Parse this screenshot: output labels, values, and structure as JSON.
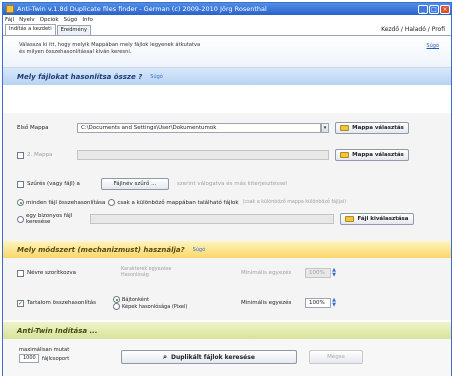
{
  "window": {
    "title": "Anti-Twin v.1.8d Duplicate files finder - German (c) 2009-2010 Jörg Rosenthal",
    "min": "_",
    "max": "□",
    "close": "×"
  },
  "menu": [
    "Fájl",
    "Nyelv",
    "Opciók",
    "Súgó",
    "Info"
  ],
  "tabs": [
    "Indítás a kezdeti",
    "Eredmény"
  ],
  "modes": "Kezdő / Haladó / Profi",
  "intro": {
    "text1": "Válassza ki itt, hogy melyik Mappában mely fájlok legyenek átkutatva",
    "text2": "és milyen összehasonlítással kíván keresni.",
    "help": "Súgó"
  },
  "section1": {
    "title": "Mely fájlokat hasonlítsa össze ?",
    "link": "Súgó"
  },
  "base_folder": {
    "label": "Első Mappa",
    "path": "C:\\Documents and Settings\\User\\Dokumentumok",
    "button": "Mappa választás"
  },
  "second_folder": {
    "label": "2. Mappa",
    "path": "",
    "button": "Mappa választás"
  },
  "filter": {
    "label": "Szűrés (vagy fájl) a",
    "button": "Fájlnév szűrő ...",
    "extra": "szerint válogatva és más kiterjesztéssel"
  },
  "scope": {
    "opt_all": "minden fájl összehasonlítása",
    "opt_sub": "csak a különböző mappában található fájlok",
    "opt_sub_extra": "(csak a különböző mappa különböző fájljai)",
    "opt_one": "egy bizonyos fájl keresése",
    "button": "Fájl kiválasztása"
  },
  "section2": {
    "title": "Mely módszert (mechanizmust) használja?",
    "link": "Súgó"
  },
  "method_name": {
    "label": "Névre szorítkozva",
    "opt1": "Karakterek egyezése",
    "opt2": "Hasonlóság",
    "extra_label": "Minimális egyezés",
    "extra_value": "100%"
  },
  "method_content": {
    "label": "Tartalom összehasonlítás",
    "opt1": "Bájtonként",
    "opt2": "Képek hasonlósága (Pixel)",
    "extra_label": "Minimális egyezés",
    "extra_value": "100%"
  },
  "section3": {
    "title": "Anti-Twin Indítása ..."
  },
  "run": {
    "limit_label": "maximálisan mutat",
    "limit_value": "1000",
    "limit_unit": "fájlcsoport",
    "start_button": "Duplikált fájlok keresése",
    "stop_button": "Mégse"
  }
}
